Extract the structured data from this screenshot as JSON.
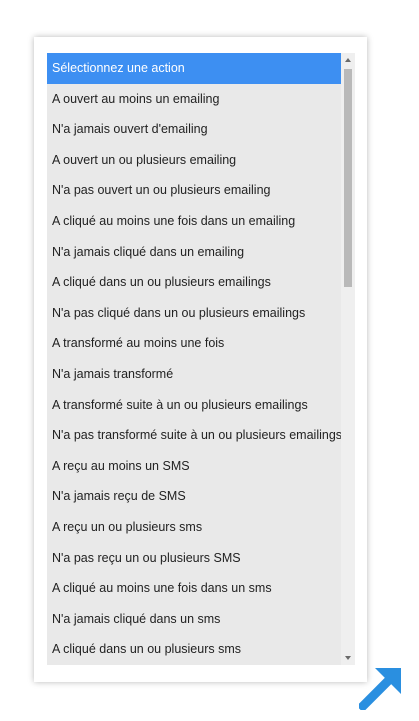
{
  "listbox": {
    "options": [
      "Sélectionnez une action",
      "A ouvert au moins un emailing",
      "N'a jamais ouvert d'emailing",
      "A ouvert un ou plusieurs emailing",
      "N'a pas ouvert un ou plusieurs emailing",
      "A cliqué au moins une fois dans un emailing",
      "N'a jamais cliqué dans un emailing",
      "A cliqué dans un ou plusieurs emailings",
      "N'a pas cliqué dans un ou plusieurs emailings",
      "A transformé au moins une fois",
      "N'a jamais transformé",
      "A transformé suite à un ou plusieurs emailings",
      "N'a pas transformé suite à un ou plusieurs emailings",
      "A reçu au moins un SMS",
      "N'a jamais reçu de SMS",
      "A reçu un ou plusieurs sms",
      "N'a pas reçu un ou plusieurs SMS",
      "A cliqué au moins une fois dans un sms",
      "N'a jamais cliqué dans un sms",
      "A cliqué dans un ou plusieurs sms"
    ],
    "selected_index": 0,
    "selected_color": "#3d8ff2",
    "background_color": "#e9e9e9"
  },
  "scrollbar": {
    "position_fraction": 0
  },
  "icons": {
    "scroll_up": "triangle-up-icon",
    "scroll_down": "triangle-down-icon",
    "corner": "diagonal-arrow-icon"
  },
  "accent_color": "#2a8fe0"
}
